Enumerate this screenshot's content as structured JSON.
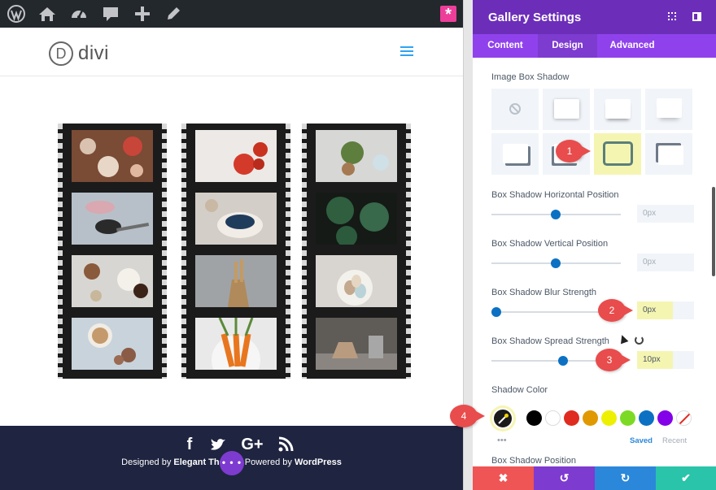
{
  "admin_bar": {
    "icons": [
      "wordpress-icon",
      "site-icon",
      "dashboard-icon",
      "comments-icon",
      "add-new-icon",
      "edit-icon"
    ],
    "builder_badge": "*"
  },
  "site": {
    "logo_letter": "D",
    "logo_name": "divi"
  },
  "footer": {
    "social_icons": [
      "f",
      "twitter-icon",
      "G+",
      "rss-icon"
    ],
    "credit_prefix": "Designed by ",
    "credit_brand": "Elegant The",
    "credit_mid": " Powered by ",
    "credit_platform": "WordPress",
    "more_button": "• • •"
  },
  "panel": {
    "title": "Gallery Settings",
    "tabs": [
      "Content",
      "Design",
      "Advanced"
    ],
    "active_tab": "Design",
    "image_box_shadow_label": "Image Box Shadow",
    "selected_preset": 6,
    "horizontal": {
      "label": "Box Shadow Horizontal Position",
      "value": "0px",
      "level": 0.5
    },
    "vertical": {
      "label": "Box Shadow Vertical Position",
      "value": "0px",
      "level": 0.5
    },
    "blur": {
      "label": "Box Shadow Blur Strength",
      "value": "0px",
      "level": 0.0
    },
    "spread": {
      "label": "Box Shadow Spread Strength",
      "value": "10px",
      "level": 0.55
    },
    "shadow_color_label": "Shadow Color",
    "color_more": "•••",
    "swatches": [
      "#000000",
      "#ffffff",
      "#e02b20",
      "#e09900",
      "#edf000",
      "#7cda24",
      "#0c71c3",
      "#8300e9"
    ],
    "saved_tab": "Saved",
    "recent_tab": "Recent",
    "position_label": "Box Shadow Position",
    "markers": [
      "1",
      "2",
      "3",
      "4"
    ],
    "bottom_colors": [
      "#ef5555",
      "#7e3bd0",
      "#2b87da",
      "#29c4a9"
    ]
  }
}
